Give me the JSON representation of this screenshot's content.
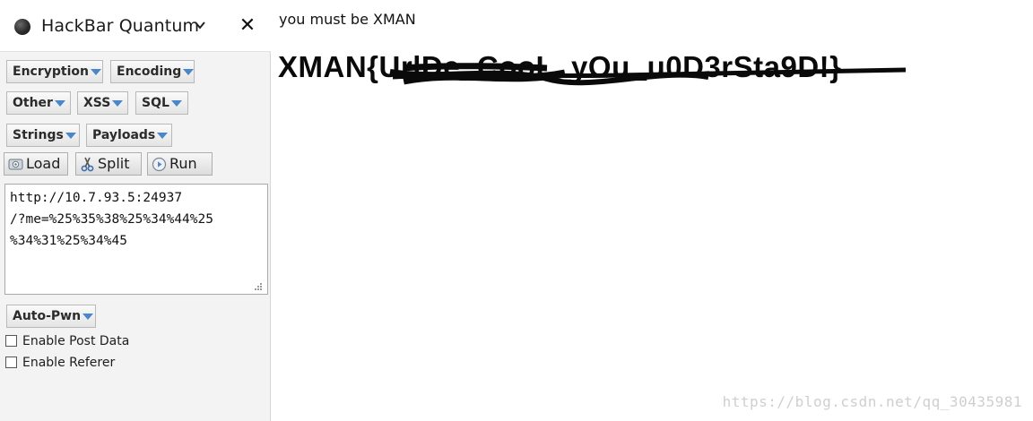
{
  "sidebar": {
    "title": "HackBar Quantum",
    "menus": {
      "encryption": "Encryption",
      "encoding": "Encoding",
      "other": "Other",
      "xss": "XSS",
      "sql": "SQL",
      "strings": "Strings",
      "payloads": "Payloads",
      "auto_pwn": "Auto-Pwn"
    },
    "buttons": {
      "load": "Load",
      "split": "Split",
      "run": "Run"
    },
    "url_value": "http://10.7.93.5:24937\n/?me=%25%35%38%25%34%44%25\n%34%31%25%34%45",
    "checkboxes": [
      {
        "label": "Enable Post Data",
        "checked": false
      },
      {
        "label": "Enable Referer",
        "checked": false
      }
    ]
  },
  "main": {
    "message": "you must be XMAN",
    "flag_prefix": "XMAN{",
    "flag_visible_tail": "UrlDe_CooL_yOu_u0D3rSta9D!}"
  },
  "watermark": "https://blog.csdn.net/qq_30435981",
  "colors": {
    "menu_arrow": "#4a86c8",
    "sidebar_bg": "#f3f3f3"
  }
}
